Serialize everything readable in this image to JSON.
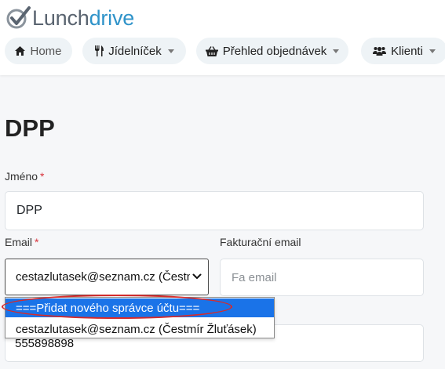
{
  "brand": {
    "name_part1": "Lunch",
    "name_part2": "drive",
    "logo_icon": "checkmark-badge-icon",
    "accent": "#2f93c9"
  },
  "nav": {
    "items": [
      {
        "label": "Home",
        "icon": "home-icon"
      },
      {
        "label": "Jídelníček",
        "icon": "fork-knife-icon"
      },
      {
        "label": "Přehled objednávek",
        "icon": "basket-icon"
      },
      {
        "label": "Klienti",
        "icon": "users-icon"
      }
    ]
  },
  "page": {
    "title": "DPP"
  },
  "form": {
    "name": {
      "label": "Jméno",
      "required_mark": "*",
      "value": "DPP"
    },
    "email": {
      "label": "Email",
      "required_mark": "*",
      "selected": "cestazlutasek@seznam.cz (Čestmír Žluťásek)",
      "options": [
        "===Přidat nového správce účtu===",
        "cestazlutasek@seznam.cz (Čestmír Žluťásek)"
      ],
      "highlighted_option": 0
    },
    "billing_email": {
      "label": "Fakturační email",
      "placeholder": "Fa email"
    },
    "phone": {
      "value": "555898898"
    }
  },
  "annotation_color": "#d62b2b"
}
